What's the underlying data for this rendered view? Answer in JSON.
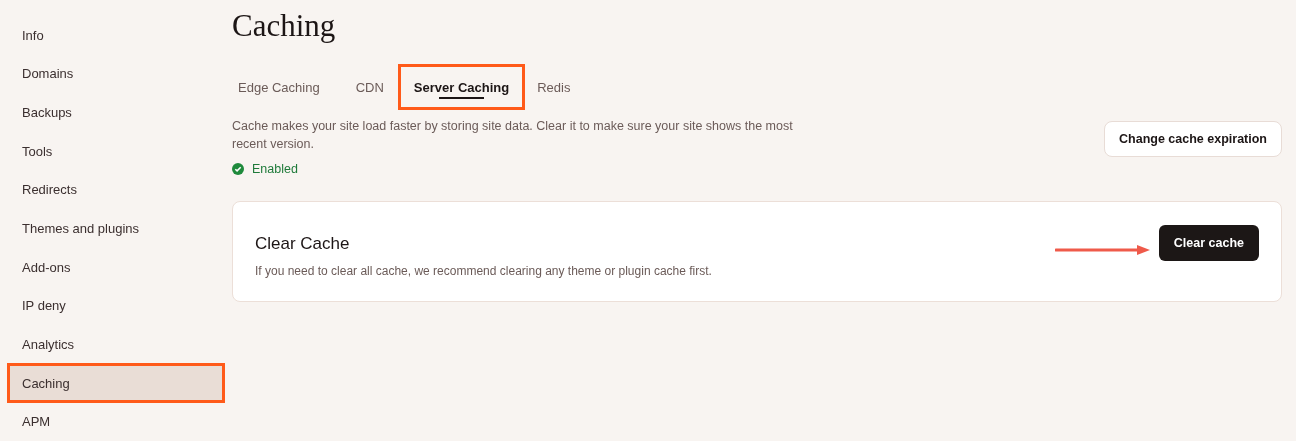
{
  "sidebar": {
    "items": [
      {
        "label": "Info",
        "selected": false,
        "highlighted": false
      },
      {
        "label": "Domains",
        "selected": false,
        "highlighted": false
      },
      {
        "label": "Backups",
        "selected": false,
        "highlighted": false
      },
      {
        "label": "Tools",
        "selected": false,
        "highlighted": false
      },
      {
        "label": "Redirects",
        "selected": false,
        "highlighted": false
      },
      {
        "label": "Themes and plugins",
        "selected": false,
        "highlighted": false
      },
      {
        "label": "Add-ons",
        "selected": false,
        "highlighted": false
      },
      {
        "label": "IP deny",
        "selected": false,
        "highlighted": false
      },
      {
        "label": "Analytics",
        "selected": false,
        "highlighted": false
      },
      {
        "label": "Caching",
        "selected": true,
        "highlighted": true
      },
      {
        "label": "APM",
        "selected": false,
        "highlighted": false
      }
    ]
  },
  "page_title": "Caching",
  "tabs": [
    {
      "label": "Edge Caching",
      "selected": false,
      "highlighted": false
    },
    {
      "label": "CDN",
      "selected": false,
      "highlighted": false
    },
    {
      "label": "Server Caching",
      "selected": true,
      "highlighted": true
    },
    {
      "label": "Redis",
      "selected": false,
      "highlighted": false
    }
  ],
  "description": "Cache makes your site load faster by storing site data. Clear it to make sure your site shows the most recent version.",
  "status": {
    "label": "Enabled",
    "enabled": true
  },
  "expiration_button": "Change cache expiration",
  "card": {
    "title": "Clear Cache",
    "text": "If you need to clear all cache, we recommend clearing any theme or plugin cache first.",
    "button": "Clear cache",
    "arrow": true
  }
}
